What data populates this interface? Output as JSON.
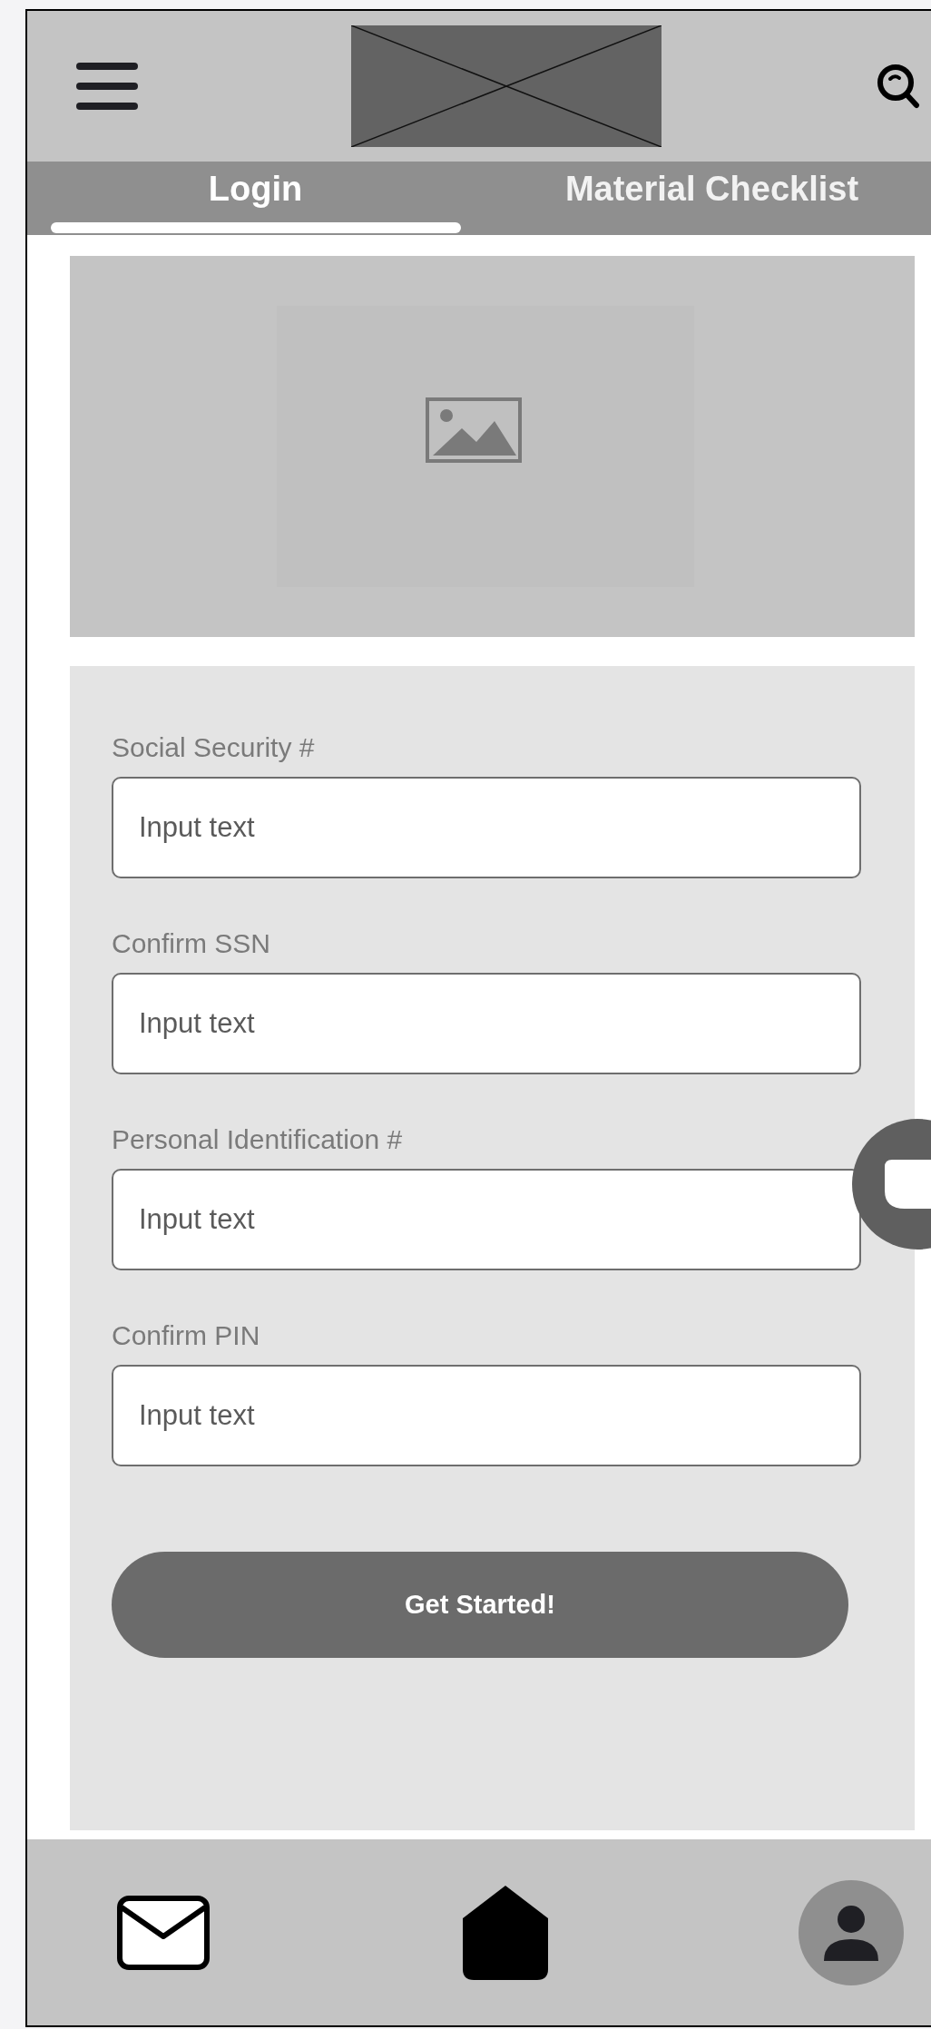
{
  "tabs": [
    {
      "label": "Login",
      "selected": true
    },
    {
      "label": "Material Checklist",
      "selected": false
    }
  ],
  "form": {
    "fields": [
      {
        "label": "Social Security #",
        "placeholder": "Input text"
      },
      {
        "label": "Confirm SSN",
        "placeholder": "Input text"
      },
      {
        "label": "Personal Identification #",
        "placeholder": "Input text"
      },
      {
        "label": "Confirm PIN",
        "placeholder": "Input text"
      }
    ],
    "submit": "Get Started!"
  },
  "bottom_nav": [
    {
      "kind": "mail"
    },
    {
      "kind": "home"
    },
    {
      "kind": "profile"
    }
  ]
}
